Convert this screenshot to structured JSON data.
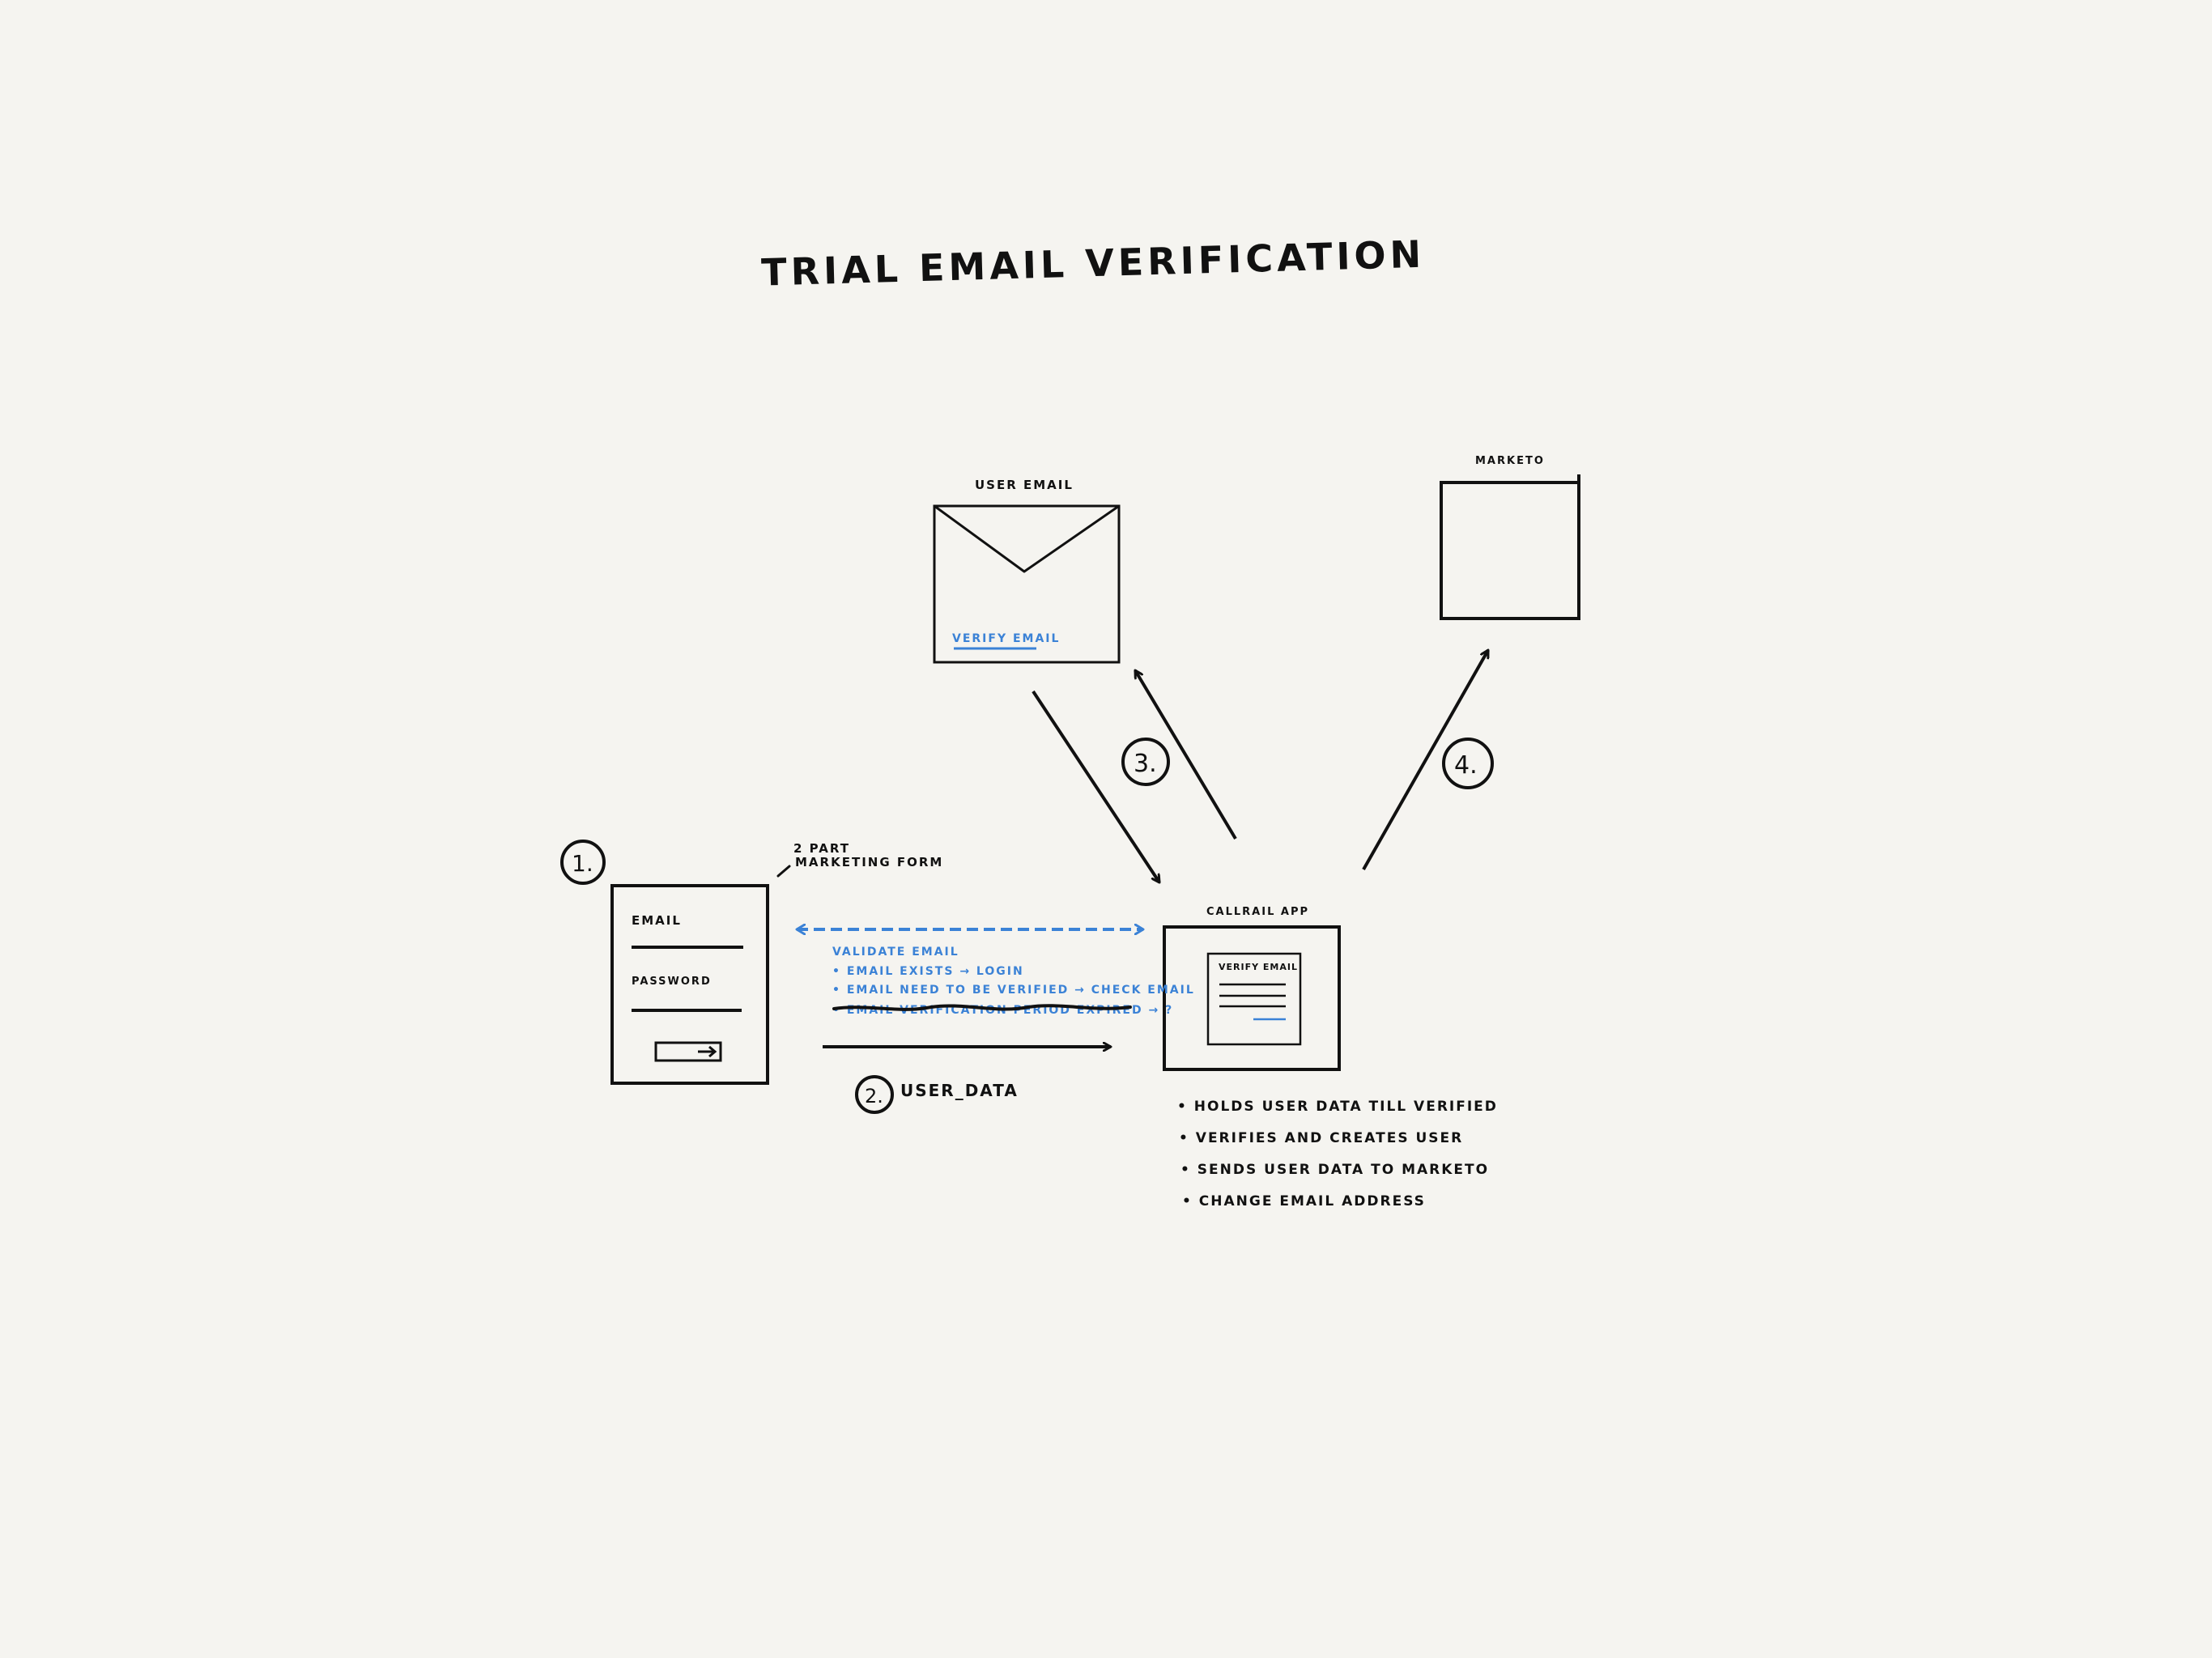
{
  "title": "TRIAL EMAIL VERIFICATION",
  "colors": {
    "ink": "#111111",
    "accent": "#3b82d6",
    "background": "#f5f4f0"
  },
  "marketing_form": {
    "step": "1.",
    "caption_line1": "2 PART",
    "caption_line2": "MARKETING FORM",
    "email_label": "EMAIL",
    "password_label": "PASSWORD",
    "submit_icon": "arrow-right-icon"
  },
  "user_email": {
    "label": "USER EMAIL",
    "link": "VERIFY EMAIL",
    "icon": "envelope-icon"
  },
  "marketo": {
    "label": "MARKETO"
  },
  "callrail_app": {
    "label": "CALLRAIL APP",
    "screen_title": "VERIFY EMAIL"
  },
  "validation": {
    "heading": "VALIDATE EMAIL",
    "items": [
      "• EMAIL EXISTS → LOGIN",
      "• EMAIL NEED TO BE VERIFIED → CHECK EMAIL",
      "• EMAIL VERIFICATION PERIOD EXPIRED → ?"
    ]
  },
  "step2": {
    "number": "2.",
    "label": "USER_DATA"
  },
  "step3": {
    "number": "3."
  },
  "step4": {
    "number": "4."
  },
  "app_notes": [
    "• HOLDS USER DATA TILL VERIFIED",
    "• VERIFIES AND CREATES USER",
    "• SENDS USER DATA TO MARKETO",
    "• CHANGE EMAIL ADDRESS"
  ]
}
